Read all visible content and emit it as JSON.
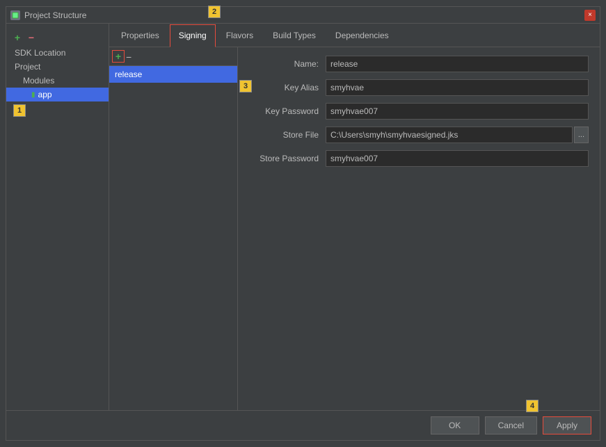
{
  "window": {
    "title": "Project Structure",
    "close_icon": "×"
  },
  "badges": {
    "b1": "1",
    "b2": "2",
    "b3": "3",
    "b4": "4"
  },
  "sidebar": {
    "add_label": "+",
    "remove_label": "−",
    "items": [
      {
        "label": "SDK Location",
        "level": 0
      },
      {
        "label": "Project",
        "level": 0
      },
      {
        "label": "Modules",
        "level": 1
      },
      {
        "label": "app",
        "level": 2,
        "selected": true
      }
    ]
  },
  "tabs": [
    {
      "label": "Properties",
      "active": false
    },
    {
      "label": "Signing",
      "active": true
    },
    {
      "label": "Flavors",
      "active": false
    },
    {
      "label": "Build Types",
      "active": false
    },
    {
      "label": "Dependencies",
      "active": false
    }
  ],
  "signing": {
    "list": {
      "add_label": "+",
      "remove_label": "−",
      "items": [
        {
          "label": "release",
          "selected": true
        }
      ]
    },
    "form": {
      "name_label": "Name:",
      "name_value": "release",
      "key_alias_label": "Key Alias",
      "key_alias_value": "smyhvae",
      "key_password_label": "Key Password",
      "key_password_value": "smyhvae007",
      "store_file_label": "Store File",
      "store_file_value": "C:\\Users\\smyh\\smyhvaesigned.jks",
      "browse_label": "...",
      "store_password_label": "Store Password",
      "store_password_value": "smyhvae007"
    }
  },
  "footer": {
    "ok_label": "OK",
    "cancel_label": "Cancel",
    "apply_label": "Apply"
  }
}
